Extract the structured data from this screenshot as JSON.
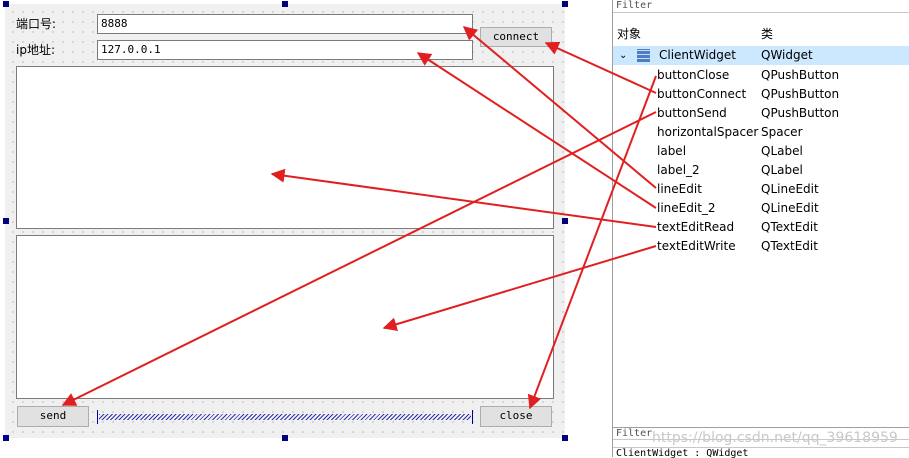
{
  "form": {
    "port_label": "端口号:",
    "port_value": "8888",
    "ip_label": "ip地址:",
    "ip_value": "127.0.0.1",
    "connect_label": "connect",
    "send_label": "send",
    "close_label": "close"
  },
  "inspector": {
    "filter_top": "Filter",
    "col_object": "对象",
    "col_class": "类",
    "root": {
      "name": "ClientWidget",
      "class": "QWidget"
    },
    "items": [
      {
        "name": "buttonClose",
        "class": "QPushButton"
      },
      {
        "name": "buttonConnect",
        "class": "QPushButton"
      },
      {
        "name": "buttonSend",
        "class": "QPushButton"
      },
      {
        "name": "horizontalSpacer",
        "class": "Spacer"
      },
      {
        "name": "label",
        "class": "QLabel"
      },
      {
        "name": "label_2",
        "class": "QLabel"
      },
      {
        "name": "lineEdit",
        "class": "QLineEdit"
      },
      {
        "name": "lineEdit_2",
        "class": "QLineEdit"
      },
      {
        "name": "textEditRead",
        "class": "QTextEdit"
      },
      {
        "name": "textEditWrite",
        "class": "QTextEdit"
      }
    ],
    "filter_bottom": "Filter",
    "status": "ClientWidget : QWidget"
  },
  "watermark": "https://blog.csdn.net/qq_39618959",
  "colors": {
    "arrow": "#e02020",
    "selection": "#cce8ff",
    "handle": "#000080"
  }
}
